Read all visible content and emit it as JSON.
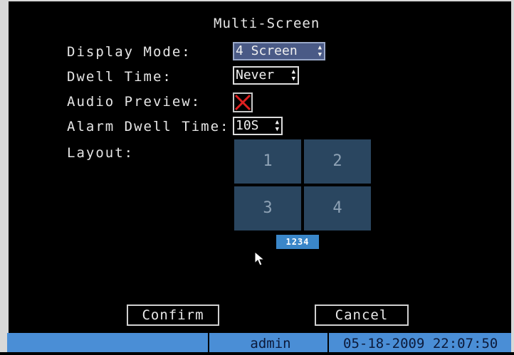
{
  "title": "Multi-Screen",
  "fields": {
    "display_mode": {
      "label": "Display Mode:",
      "value": "4 Screen"
    },
    "dwell_time": {
      "label": "Dwell Time:",
      "value": "Never"
    },
    "audio_preview": {
      "label": "Audio Preview:",
      "checked": false
    },
    "alarm_dwell_time": {
      "label": "Alarm Dwell Time:",
      "value": "10S"
    },
    "layout": {
      "label": "Layout:"
    }
  },
  "layout_grid": [
    "1",
    "2",
    "3",
    "4"
  ],
  "layout_pages": "1234",
  "buttons": {
    "confirm": "Confirm",
    "cancel": "Cancel"
  },
  "status_bar": {
    "user": "admin",
    "datetime": "05-18-2009 22:07:50"
  },
  "colors": {
    "focus": "#4a5a86",
    "grid_cell": "#2a4660",
    "status_bar": "#4a8ed6",
    "checkbox_x": "#e02020"
  },
  "icons": [
    "up-down-arrow-icon",
    "x-mark-icon",
    "mouse-pointer-icon"
  ]
}
